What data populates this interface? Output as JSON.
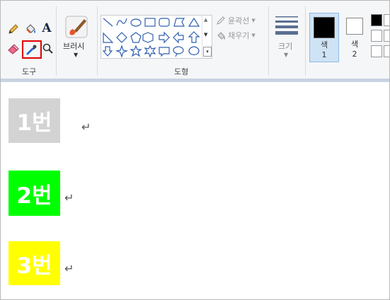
{
  "ribbon": {
    "groups": {
      "tools_label": "도구",
      "shapes_label": "도형"
    },
    "brush_label": "브러시",
    "outline_label": "윤곽선",
    "fill_label": "채우기",
    "size_label": "크기",
    "color1_label_line1": "색",
    "color1_label_line2": "1",
    "color2_label_line1": "색",
    "color2_label_line2": "2",
    "text_tool_glyph": "A",
    "color1_value": "#000000",
    "color2_value": "#ffffff",
    "highlight_color": "#e00000"
  },
  "canvas": {
    "items": [
      {
        "text": "1번",
        "background": "#d3d3d3"
      },
      {
        "text": "2번",
        "background": "#00ff00"
      },
      {
        "text": "3번",
        "background": "#ffff00"
      }
    ],
    "paragraph_mark": "↵"
  }
}
